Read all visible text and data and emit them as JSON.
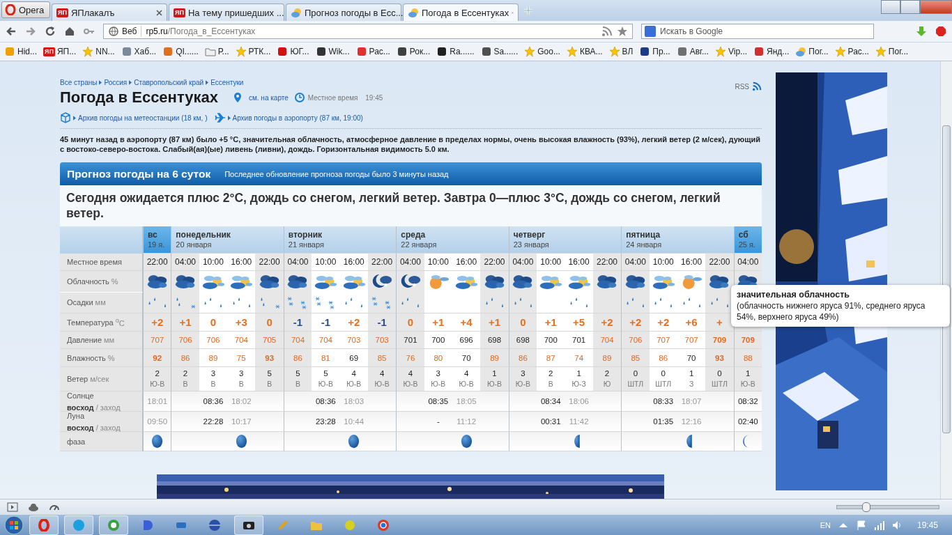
{
  "browser": {
    "opera_button": "Opera",
    "tabs": [
      {
        "icon": {
          "kind": "badge",
          "badge": "ЯП"
        },
        "label": "ЯПлакалъ",
        "selected": false
      },
      {
        "icon": {
          "kind": "badge",
          "badge": "ЯП"
        },
        "label": "На тему пришедших ...",
        "selected": false
      },
      {
        "icon": {
          "kind": "weather"
        },
        "label": "Прогноз погоды в Есс...",
        "selected": false
      },
      {
        "icon": {
          "kind": "weather"
        },
        "label": "Погода в Ессентуках",
        "selected": true
      }
    ],
    "address": {
      "site_label": "Веб",
      "url_host": "rp5.ru",
      "url_path": "/Погода_в_Ессентуках"
    },
    "search": {
      "placeholder": "Искать в Google"
    },
    "bookmarks": [
      {
        "kind": "site",
        "color": "#f0a000",
        "label": "Hid..."
      },
      {
        "kind": "badge",
        "badge": "ЯП",
        "label": "ЯП..."
      },
      {
        "kind": "star",
        "label": "NN..."
      },
      {
        "kind": "site",
        "color": "#7a8a9a",
        "label": "Хаб..."
      },
      {
        "kind": "site",
        "color": "#e07020",
        "label": "QI......"
      },
      {
        "kind": "folder",
        "label": "Р..."
      },
      {
        "kind": "star",
        "label": "РТК..."
      },
      {
        "kind": "site",
        "color": "#d01010",
        "label": "ЮГ..."
      },
      {
        "kind": "site",
        "color": "#333333",
        "label": "Wik..."
      },
      {
        "kind": "site",
        "color": "#e03030",
        "label": "Рас..."
      },
      {
        "kind": "site",
        "color": "#404040",
        "label": "Рок..."
      },
      {
        "kind": "site",
        "color": "#202020",
        "label": "Ra......"
      },
      {
        "kind": "site",
        "color": "#505050",
        "label": "Sa......"
      },
      {
        "kind": "star",
        "label": "Goo..."
      },
      {
        "kind": "star",
        "label": "КВА..."
      },
      {
        "kind": "star",
        "label": "ВЛ"
      },
      {
        "kind": "site",
        "color": "#1a3a8a",
        "label": "Пр..."
      },
      {
        "kind": "site",
        "color": "#707070",
        "label": "Авг..."
      },
      {
        "kind": "star",
        "label": "Vip..."
      },
      {
        "kind": "site",
        "color": "#d03030",
        "label": "Янд..."
      },
      {
        "kind": "weather",
        "label": "Пог..."
      },
      {
        "kind": "star",
        "label": "Рас..."
      },
      {
        "kind": "star",
        "label": "Пог..."
      }
    ]
  },
  "page": {
    "breadcrumbs": [
      "Все страны",
      "Россия",
      "Ставропольский край",
      "Ессентуки"
    ],
    "rss": "RSS",
    "title": "Погода в Ессентуках",
    "map_link": "см. на карте",
    "local_time_label": "Местное время",
    "local_time": "19:45",
    "archive_links": [
      "Архив погоды на метеостанции (18 км, )",
      "Архив погоды в аэропорту (87 км, 19:00)"
    ],
    "observation": "45 минут назад в аэропорту (87 км) было +5 °C, значительная облачность, атмосферное давление в пределах нормы, очень высокая влажность (93%), легкий ветер (2 м/сек), дующий с востоко-северо-востока. Слабый(ая)(ые) ливень (ливни), дождь. Горизонтальная видимость 5.0 км.",
    "forecast": {
      "title": "Прогноз погоды на 6 суток",
      "updated": "Последнее обновление прогноза погоды было 3 минуты назад",
      "summary": "Сегодня ожидается плюс 2°C, дождь со снегом, легкий ветер. Завтра 0—плюс 3°C, дождь со снегом, легкий ветер.",
      "row_labels": [
        {
          "name": "Местное время"
        },
        {
          "name": "Облачность",
          "unit": "%"
        },
        {
          "name": "Осадки",
          "unit": "мм"
        },
        {
          "name": "Температура",
          "unit": "$^{o}$C"
        },
        {
          "name": "Давление",
          "unit": "мм"
        },
        {
          "name": "Влажность",
          "unit": "%"
        },
        {
          "name": "Ветер",
          "unit": "м/сек"
        },
        {
          "name": "Солнце",
          "sub": "**восход** / заход"
        },
        {
          "name": "Луна",
          "sub": "**восход** / заход"
        },
        {
          "name": "фаза"
        }
      ],
      "days": [
        {
          "name": "вс",
          "date": "19 я.",
          "kind": "short",
          "slots": [
            {
              "time": "22:00",
              "daytime": false,
              "cloud": {
                "kind": "overcast"
              },
              "precip": {
                "kind": "rain"
              },
              "temp": {
                "text": "+2",
                "kind": "warm"
              },
              "pressure": {
                "text": "707",
                "kind": "warn"
              },
              "humidity": {
                "text": "92",
                "kind": "alert"
              },
              "wind_speed": "2",
              "wind_dir": "Ю-В",
              "sun": {
                "text": "18:01",
                "kind": "set"
              },
              "moon": {
                "text": "09:50",
                "kind": "set"
              },
              "phase": {
                "kind": "full"
              }
            }
          ]
        },
        {
          "name": "понедельник",
          "date": "20 января",
          "kind": "full",
          "slots": [
            {
              "time": "04:00",
              "daytime": false,
              "cloud": {
                "kind": "overcast"
              },
              "precip": {
                "kind": "mixed"
              },
              "temp": {
                "text": "+1",
                "kind": "warm"
              },
              "pressure": {
                "text": "706",
                "kind": "warn"
              },
              "humidity": {
                "text": "86",
                "kind": "warn"
              },
              "wind_speed": "2",
              "wind_dir": "В"
            },
            {
              "time": "10:00",
              "daytime": true,
              "cloud": {
                "kind": "partly"
              },
              "precip": {
                "kind": "rain"
              },
              "temp": {
                "text": "0",
                "kind": "warm"
              },
              "pressure": {
                "text": "706",
                "kind": "warn"
              },
              "humidity": {
                "text": "89",
                "kind": "warn"
              },
              "wind_speed": "3",
              "wind_dir": "В",
              "sun": {
                "text": "08:36",
                "kind": "rise"
              },
              "moon": {
                "text": "22:28",
                "kind": "rise"
              }
            },
            {
              "time": "16:00",
              "daytime": true,
              "cloud": {
                "kind": "partly"
              },
              "precip": {
                "kind": "rain"
              },
              "temp": {
                "text": "+3",
                "kind": "warm"
              },
              "pressure": {
                "text": "704",
                "kind": "warn"
              },
              "humidity": {
                "text": "75",
                "kind": "warn"
              },
              "wind_speed": "3",
              "wind_dir": "В",
              "sun": {
                "text": "18:02",
                "kind": "set"
              },
              "moon": {
                "text": "10:17",
                "kind": "set"
              },
              "phase": {
                "kind": "full"
              }
            },
            {
              "time": "22:00",
              "daytime": false,
              "cloud": {
                "kind": "overcast"
              },
              "precip": {
                "kind": "mixed"
              },
              "temp": {
                "text": "0",
                "kind": "warm"
              },
              "pressure": {
                "text": "705",
                "kind": "warn"
              },
              "humidity": {
                "text": "93",
                "kind": "alert"
              },
              "wind_speed": "5",
              "wind_dir": "В"
            }
          ]
        },
        {
          "name": "вторник",
          "date": "21 января",
          "kind": "full",
          "slots": [
            {
              "time": "04:00",
              "daytime": false,
              "cloud": {
                "kind": "overcast"
              },
              "precip": {
                "kind": "snow"
              },
              "temp": {
                "text": "-1",
                "kind": "cold"
              },
              "pressure": {
                "text": "704",
                "kind": "warn"
              },
              "humidity": {
                "text": "86",
                "kind": "warn"
              },
              "wind_speed": "5",
              "wind_dir": "В"
            },
            {
              "time": "10:00",
              "daytime": true,
              "cloud": {
                "kind": "partly"
              },
              "precip": {
                "kind": "snow"
              },
              "temp": {
                "text": "-1",
                "kind": "cold"
              },
              "pressure": {
                "text": "704",
                "kind": "warn"
              },
              "humidity": {
                "text": "81",
                "kind": "warn"
              },
              "wind_speed": "5",
              "wind_dir": "Ю-В",
              "sun": {
                "text": "08:36",
                "kind": "rise"
              },
              "moon": {
                "text": "23:28",
                "kind": "rise"
              }
            },
            {
              "time": "16:00",
              "daytime": true,
              "cloud": {
                "kind": "partly"
              },
              "precip": {
                "kind": "rain"
              },
              "temp": {
                "text": "+2",
                "kind": "warm"
              },
              "pressure": {
                "text": "703",
                "kind": "warn"
              },
              "humidity": {
                "text": "69",
                "kind": "normal"
              },
              "wind_speed": "4",
              "wind_dir": "Ю-В",
              "sun": {
                "text": "18:03",
                "kind": "set"
              },
              "moon": {
                "text": "10:44",
                "kind": "set"
              },
              "phase": {
                "kind": "full"
              }
            },
            {
              "time": "22:00",
              "daytime": false,
              "cloud": {
                "kind": "night"
              },
              "precip": {
                "kind": "snow"
              },
              "temp": {
                "text": "-1",
                "kind": "cold"
              },
              "pressure": {
                "text": "703",
                "kind": "warn"
              },
              "humidity": {
                "text": "85",
                "kind": "warn"
              },
              "wind_speed": "4",
              "wind_dir": "Ю-В"
            }
          ]
        },
        {
          "name": "среда",
          "date": "22 января",
          "kind": "full",
          "slots": [
            {
              "time": "04:00",
              "daytime": false,
              "cloud": {
                "kind": "night"
              },
              "precip": {
                "kind": "rain"
              },
              "temp": {
                "text": "0",
                "kind": "warm"
              },
              "pressure": {
                "text": "701",
                "kind": "normal"
              },
              "humidity": {
                "text": "76",
                "kind": "warn"
              },
              "wind_speed": "4",
              "wind_dir": "Ю-В"
            },
            {
              "time": "10:00",
              "daytime": true,
              "cloud": {
                "kind": "sunny"
              },
              "temp": {
                "text": "+1",
                "kind": "warm"
              },
              "pressure": {
                "text": "700",
                "kind": "normal"
              },
              "humidity": {
                "text": "80",
                "kind": "warn"
              },
              "wind_speed": "3",
              "wind_dir": "Ю-В",
              "sun": {
                "text": "08:35",
                "kind": "rise"
              },
              "moon": {
                "text": "-",
                "kind": "rise"
              }
            },
            {
              "time": "16:00",
              "daytime": true,
              "cloud": {
                "kind": "partly"
              },
              "temp": {
                "text": "+4",
                "kind": "warm"
              },
              "pressure": {
                "text": "696",
                "kind": "normal"
              },
              "humidity": {
                "text": "70",
                "kind": "normal"
              },
              "wind_speed": "4",
              "wind_dir": "Ю-В",
              "sun": {
                "text": "18:05",
                "kind": "set"
              },
              "moon": {
                "text": "11:12",
                "kind": "set"
              },
              "phase": {
                "kind": "full"
              }
            },
            {
              "time": "22:00",
              "daytime": false,
              "cloud": {
                "kind": "overcast"
              },
              "precip": {
                "kind": "rain"
              },
              "temp": {
                "text": "+1",
                "kind": "warm"
              },
              "pressure": {
                "text": "698",
                "kind": "normal"
              },
              "humidity": {
                "text": "89",
                "kind": "warn"
              },
              "wind_speed": "1",
              "wind_dir": "Ю-В"
            }
          ]
        },
        {
          "name": "четверг",
          "date": "23 января",
          "kind": "full",
          "slots": [
            {
              "time": "04:00",
              "daytime": false,
              "cloud": {
                "kind": "overcast"
              },
              "precip": {
                "kind": "rain"
              },
              "temp": {
                "text": "0",
                "kind": "warm"
              },
              "pressure": {
                "text": "698",
                "kind": "normal"
              },
              "humidity": {
                "text": "86",
                "kind": "warn"
              },
              "wind_speed": "3",
              "wind_dir": "Ю-В"
            },
            {
              "time": "10:00",
              "daytime": true,
              "cloud": {
                "kind": "partly"
              },
              "temp": {
                "text": "+1",
                "kind": "warm"
              },
              "pressure": {
                "text": "700",
                "kind": "normal"
              },
              "humidity": {
                "text": "87",
                "kind": "warn"
              },
              "wind_speed": "2",
              "wind_dir": "В",
              "sun": {
                "text": "08:34",
                "kind": "rise"
              },
              "moon": {
                "text": "00:31",
                "kind": "rise"
              }
            },
            {
              "time": "16:00",
              "daytime": true,
              "cloud": {
                "kind": "partly"
              },
              "precip": {
                "kind": "rain"
              },
              "temp": {
                "text": "+5",
                "kind": "warm"
              },
              "pressure": {
                "text": "701",
                "kind": "normal"
              },
              "humidity": {
                "text": "74",
                "kind": "warn"
              },
              "wind_speed": "1",
              "wind_dir": "Ю-З",
              "sun": {
                "text": "18:06",
                "kind": "set"
              },
              "moon": {
                "text": "11:42",
                "kind": "set"
              },
              "phase": {
                "kind": "half"
              }
            },
            {
              "time": "22:00",
              "daytime": false,
              "cloud": {
                "kind": "overcast"
              },
              "temp": {
                "text": "+2",
                "kind": "warm"
              },
              "pressure": {
                "text": "704",
                "kind": "warn"
              },
              "humidity": {
                "text": "89",
                "kind": "warn"
              },
              "wind_speed": "2",
              "wind_dir": "Ю"
            }
          ]
        },
        {
          "name": "пятница",
          "date": "24 января",
          "kind": "full",
          "slots": [
            {
              "time": "04:00",
              "daytime": false,
              "cloud": {
                "kind": "overcast"
              },
              "precip": {
                "kind": "rain"
              },
              "temp": {
                "text": "+2",
                "kind": "warm"
              },
              "pressure": {
                "text": "706",
                "kind": "warn"
              },
              "humidity": {
                "text": "85",
                "kind": "warn"
              },
              "wind_speed": "0",
              "wind_dir": "ШТЛ"
            },
            {
              "time": "10:00",
              "daytime": true,
              "cloud": {
                "kind": "partly"
              },
              "precip": {
                "kind": "rain"
              },
              "temp": {
                "text": "+2",
                "kind": "warm"
              },
              "pressure": {
                "text": "707",
                "kind": "warn"
              },
              "humidity": {
                "text": "86",
                "kind": "warn"
              },
              "wind_speed": "0",
              "wind_dir": "ШТЛ",
              "sun": {
                "text": "08:33",
                "kind": "rise"
              },
              "moon": {
                "text": "01:35",
                "kind": "rise"
              }
            },
            {
              "time": "16:00",
              "daytime": true,
              "cloud": {
                "kind": "sunny"
              },
              "precip": {
                "kind": "rain"
              },
              "temp": {
                "text": "+6",
                "kind": "warm"
              },
              "pressure": {
                "text": "707",
                "kind": "warn"
              },
              "humidity": {
                "text": "70",
                "kind": "normal"
              },
              "wind_speed": "1",
              "wind_dir": "З",
              "sun": {
                "text": "18:07",
                "kind": "set"
              },
              "moon": {
                "text": "12:16",
                "kind": "set"
              },
              "phase": {
                "kind": "half"
              }
            },
            {
              "time": "22:00",
              "daytime": false,
              "cloud": {
                "kind": "overcast"
              },
              "precip": {
                "kind": "rain"
              },
              "temp": {
                "text": "+",
                "kind": "warm"
              },
              "pressure": {
                "text": "709",
                "kind": "alert"
              },
              "humidity": {
                "text": "93",
                "kind": "alert"
              },
              "wind_speed": "0",
              "wind_dir": "ШТЛ"
            }
          ]
        },
        {
          "name": "сб",
          "date": "25 я.",
          "kind": "short",
          "slots": [
            {
              "time": "04:00",
              "daytime": false,
              "cloud": {
                "kind": "overcast"
              },
              "pressure": {
                "text": "709",
                "kind": "alert"
              },
              "humidity": {
                "text": "88",
                "kind": "warn"
              },
              "wind_speed": "1",
              "wind_dir": "Ю-В",
              "sun": {
                "text": "08:32",
                "kind": "rise"
              },
              "moon": {
                "text": "02:40",
                "kind": "rise"
              },
              "phase": {
                "kind": "crescent"
              }
            }
          ]
        }
      ]
    },
    "tooltip": {
      "title": "значительная облачность",
      "text": "(облачность нижнего яруса 91%, среднего яруса 54%, верхнего яруса 49%)"
    }
  },
  "status_bar": {
    "zoom": {
      "level": 0.28
    }
  },
  "taskbar": {
    "language": "EN",
    "clock": "19:45"
  }
}
